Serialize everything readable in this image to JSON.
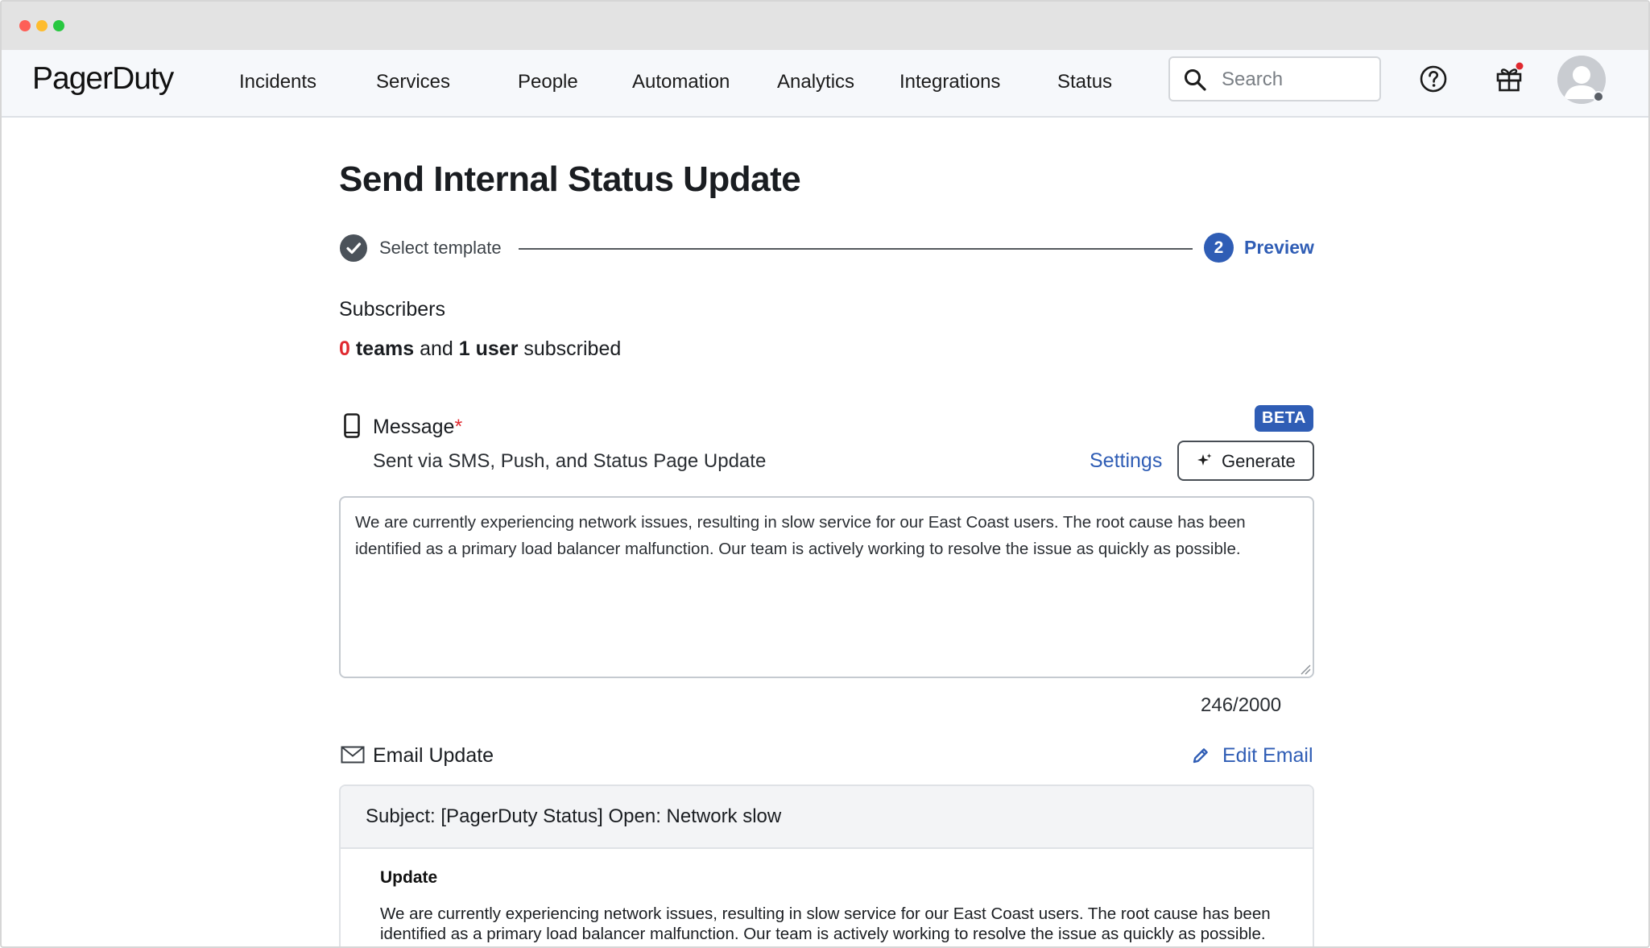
{
  "browser": {
    "dots": [
      "#fe5f57",
      "#febc2e",
      "#28c840"
    ]
  },
  "nav": {
    "logo": "PagerDuty",
    "items": [
      {
        "label": "Incidents"
      },
      {
        "label": "Services"
      },
      {
        "label": "People"
      },
      {
        "label": "Automation"
      },
      {
        "label": "Analytics"
      },
      {
        "label": "Integrations"
      },
      {
        "label": "Status"
      }
    ],
    "search_placeholder": "Search",
    "icons": [
      "search-icon",
      "help-icon",
      "gift-icon",
      "avatar"
    ]
  },
  "page": {
    "title": "Send Internal Status Update",
    "steps": [
      {
        "label": "Select template",
        "state": "complete"
      },
      {
        "number": "2",
        "label": "Preview",
        "state": "active"
      }
    ]
  },
  "subscribers": {
    "heading": "Subscribers",
    "teams_count": "0",
    "teams_word": "teams",
    "and_word": "and",
    "users_count": "1",
    "users_word": "user",
    "suffix": "subscribed"
  },
  "message": {
    "label": "Message",
    "required_mark": "*",
    "beta_badge": "BETA",
    "subtitle": "Sent via SMS, Push, and Status Page Update",
    "settings_link": "Settings",
    "generate_button": "Generate",
    "body": "We are currently experiencing network issues, resulting in slow service for our East Coast users. The root cause has been identified as a primary load balancer malfunction. Our team is actively working to resolve the issue as quickly as possible.",
    "char_count": "246/2000"
  },
  "email": {
    "label": "Email Update",
    "edit_link": "Edit Email",
    "subject": "Subject: [PagerDuty Status] Open: Network slow",
    "heading": "Update",
    "body": "We are currently experiencing network issues, resulting in slow service for our East Coast users. The root cause has been identified as a primary load balancer malfunction. Our team is actively working to resolve the issue as quickly as possible."
  },
  "colors": {
    "accent": "#2f5db5",
    "required": "#e0292f",
    "nav_bg": "#f6f8fb",
    "notification": "#e0292f"
  }
}
